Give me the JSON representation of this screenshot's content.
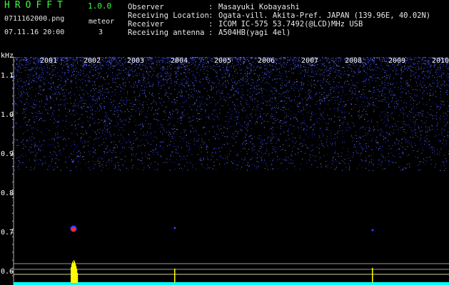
{
  "app": {
    "title": "HROFFT",
    "version": "1.0.0"
  },
  "file": {
    "name": "0711162000.png",
    "datetime": "07.11.16 20:00"
  },
  "meteor": {
    "label": "meteor",
    "count": "3"
  },
  "info": [
    {
      "label": "Observer",
      "value": "Masayuki Kobayashi"
    },
    {
      "label": "Receiving Location",
      "value": "Ogata-vill. Akita-Pref. JAPAN (139.96E, 40.02N)"
    },
    {
      "label": "Receiver",
      "value": "ICOM IC-575 53.7492(@LCD)MHz USB"
    },
    {
      "label": "Receiving antenna",
      "value": "A504HB(yagi 4el)"
    }
  ],
  "spectrogram": {
    "y_unit": "kHz",
    "y_ticks": [
      "1.1",
      "1.0",
      "0.9",
      "0.8",
      "0.7",
      "0.6"
    ],
    "x_ticks": [
      "2001",
      "2002",
      "2003",
      "2004",
      "2005",
      "2006",
      "2007",
      "2008",
      "2009",
      "2010"
    ],
    "colors": {
      "background": "#000000",
      "noise": "#2a3cff",
      "echo": "#ff2a2a",
      "signal": "#ffff00",
      "baseline": "#00ffff",
      "axis": "#b0b0b0"
    }
  }
}
